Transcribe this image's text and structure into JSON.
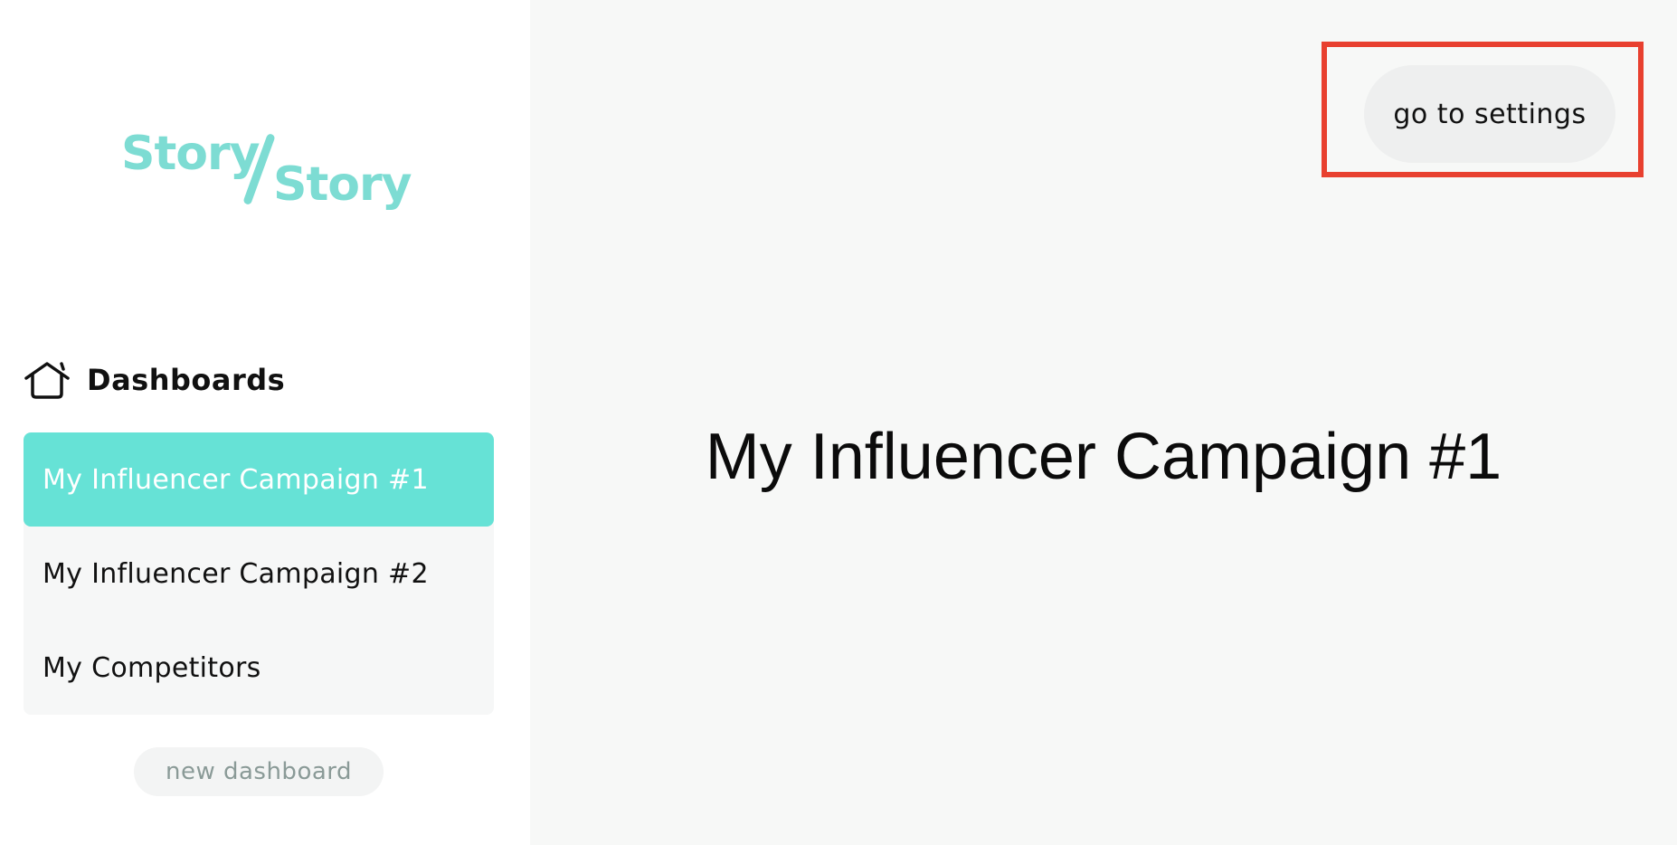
{
  "app": {
    "logo_word_1": "Story",
    "logo_word_2": "Story"
  },
  "sidebar": {
    "section_title": "Dashboards",
    "section_icon": "home-icon",
    "items": [
      {
        "label": "My Influencer Campaign #1",
        "active": true
      },
      {
        "label": "My Influencer Campaign #2",
        "active": false
      },
      {
        "label": "My Competitors",
        "active": false
      }
    ],
    "new_dashboard_label": "new dashboard"
  },
  "header": {
    "settings_label": "go to settings"
  },
  "main": {
    "title": "My Influencer Campaign #1"
  },
  "colors": {
    "accent": "#66e2d6",
    "logo": "#7ddcd3",
    "highlight": "#e8402f"
  }
}
